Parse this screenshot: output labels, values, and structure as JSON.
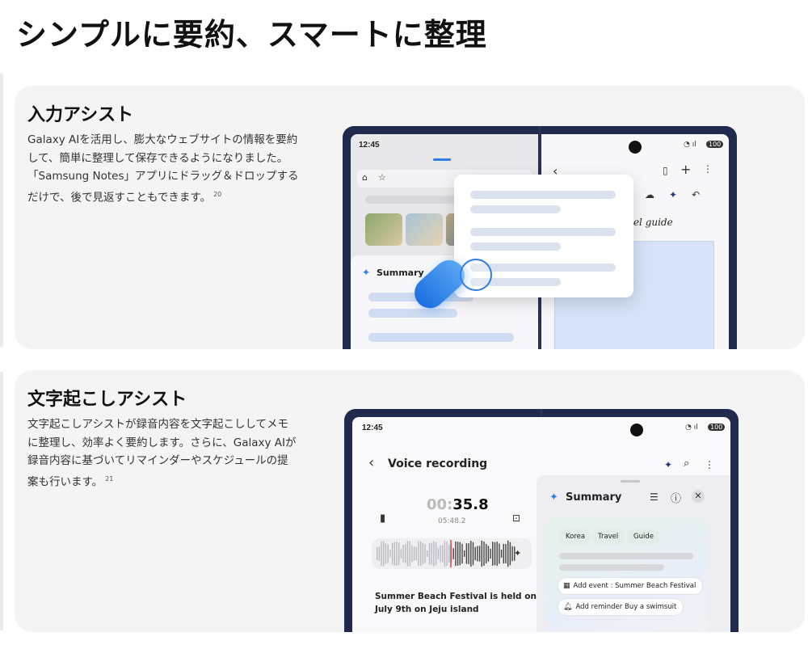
{
  "page": {
    "title": "シンプルに要約、スマートに整理"
  },
  "card1": {
    "title": "入力アシスト",
    "description": "Galaxy AIを活用し、膨大なウェブサイトの情報を要約して、簡単に整理して保存できるようになりました。「Samsung Notes」アプリにドラッグ＆ドロップするだけで、後で見返すこともできます。",
    "footnote": "20",
    "device": {
      "time": "12:45",
      "battery": "100",
      "summary_label": "Summary",
      "guide_text": "avel guide"
    }
  },
  "card2": {
    "title": "文字起こしアシスト",
    "description": "文字起こしアシストが録音内容を文字起こししてメモに整理し、効率よく要約します。さらに、Galaxy AIが録音内容に基づいてリマインダーやスケジュールの提案も行います。",
    "footnote": "21",
    "device": {
      "time": "12:45",
      "battery": "100",
      "screen_title": "Voice recording",
      "timer_dim": "00:",
      "timer_main": "35.8",
      "timer_total": "05:48.2",
      "caption": "Summer Beach Festival is held on July 9th on Jeju island",
      "summary_title": "Summary",
      "tags": [
        "Korea",
        "Travel",
        "Guide"
      ],
      "actions": [
        {
          "icon": "calendar-icon",
          "label": "Add event : Summer Beach Festival"
        },
        {
          "icon": "bell-icon",
          "label": "Add reminder Buy a swimsuit"
        }
      ]
    }
  },
  "colors": {
    "accent": "#2b7de9",
    "device_frame": "#1f2a4d",
    "card_bg": "#f4f4f4"
  }
}
